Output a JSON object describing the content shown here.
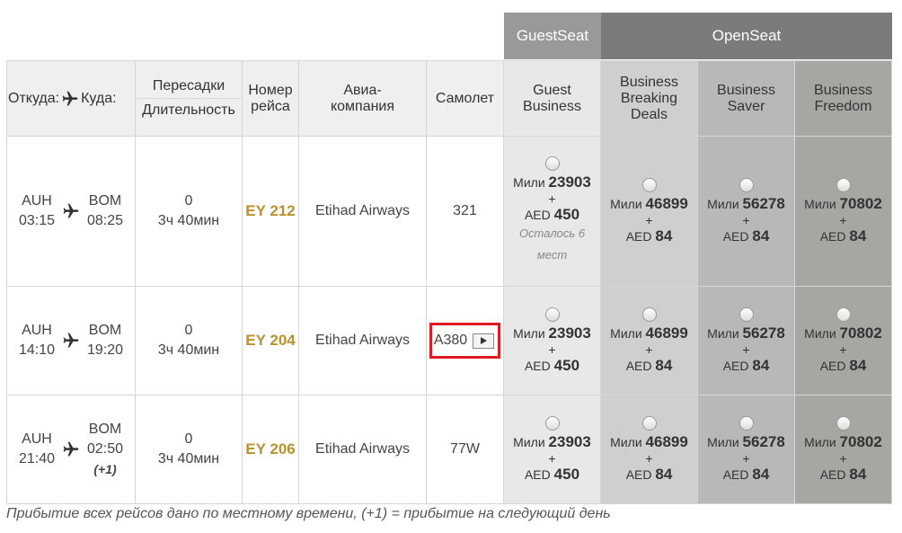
{
  "categories": {
    "guest": "GuestSeat",
    "open": "OpenSeat"
  },
  "header": {
    "from": "Откуда:",
    "to": "Куда:",
    "stops": "Пересадки",
    "duration": "Длительность",
    "flight_no_1": "Номер",
    "flight_no_2": "рейса",
    "airline_1": "Авиа-",
    "airline_2": "компания",
    "aircraft": "Самолет",
    "fares": [
      {
        "l1": "Guest",
        "l2": "Business",
        "l3": ""
      },
      {
        "l1": "Business",
        "l2": "Breaking",
        "l3": "Deals"
      },
      {
        "l1": "Business",
        "l2": "Saver",
        "l3": ""
      },
      {
        "l1": "Business",
        "l2": "Freedom",
        "l3": ""
      }
    ]
  },
  "rows": [
    {
      "dep_code": "AUH",
      "dep_time": "03:15",
      "arr_code": "BOM",
      "arr_time": "08:25",
      "next_day": "",
      "stops": "0",
      "duration": "3ч 40мин",
      "flight": "EY 212",
      "airline": "Etihad Airways",
      "aircraft": "321",
      "fares": [
        {
          "miles_label": "Мили",
          "miles": "23903",
          "plus": "+",
          "cur": "AED",
          "tax": "450",
          "note1": "Осталось 6",
          "note2": "мест"
        },
        {
          "miles_label": "Мили",
          "miles": "46899",
          "plus": "+",
          "cur": "AED",
          "tax": "84"
        },
        {
          "miles_label": "Мили",
          "miles": "56278",
          "plus": "+",
          "cur": "AED",
          "tax": "84"
        },
        {
          "miles_label": "Мили",
          "miles": "70802",
          "plus": "+",
          "cur": "AED",
          "tax": "84"
        }
      ]
    },
    {
      "dep_code": "AUH",
      "dep_time": "14:10",
      "arr_code": "BOM",
      "arr_time": "19:20",
      "next_day": "",
      "stops": "0",
      "duration": "3ч 40мин",
      "flight": "EY 204",
      "airline": "Etihad Airways",
      "aircraft": "A380",
      "fares": [
        {
          "miles_label": "Мили",
          "miles": "23903",
          "plus": "+",
          "cur": "AED",
          "tax": "450"
        },
        {
          "miles_label": "Мили",
          "miles": "46899",
          "plus": "+",
          "cur": "AED",
          "tax": "84"
        },
        {
          "miles_label": "Мили",
          "miles": "56278",
          "plus": "+",
          "cur": "AED",
          "tax": "84"
        },
        {
          "miles_label": "Мили",
          "miles": "70802",
          "plus": "+",
          "cur": "AED",
          "tax": "84"
        }
      ]
    },
    {
      "dep_code": "AUH",
      "dep_time": "21:40",
      "arr_code": "BOM",
      "arr_time": "02:50",
      "next_day": "(+1)",
      "stops": "0",
      "duration": "3ч 40мин",
      "flight": "EY 206",
      "airline": "Etihad Airways",
      "aircraft": "77W",
      "fares": [
        {
          "miles_label": "Мили",
          "miles": "23903",
          "plus": "+",
          "cur": "AED",
          "tax": "450"
        },
        {
          "miles_label": "Мили",
          "miles": "46899",
          "plus": "+",
          "cur": "AED",
          "tax": "84"
        },
        {
          "miles_label": "Мили",
          "miles": "56278",
          "plus": "+",
          "cur": "AED",
          "tax": "84"
        },
        {
          "miles_label": "Мили",
          "miles": "70802",
          "plus": "+",
          "cur": "AED",
          "tax": "84"
        }
      ]
    }
  ],
  "footnote": "Прибытие всех рейсов дано по местному времени, (+1) = прибытие на следующий день",
  "icons": {
    "plane": "airplane-icon",
    "play": "play-icon",
    "radio": "radio-button"
  },
  "colors": {
    "flight_no": "#b9912e",
    "highlight_border": "#e01b24",
    "guest_header": "#999999",
    "open_header": "#7b7b7b"
  }
}
